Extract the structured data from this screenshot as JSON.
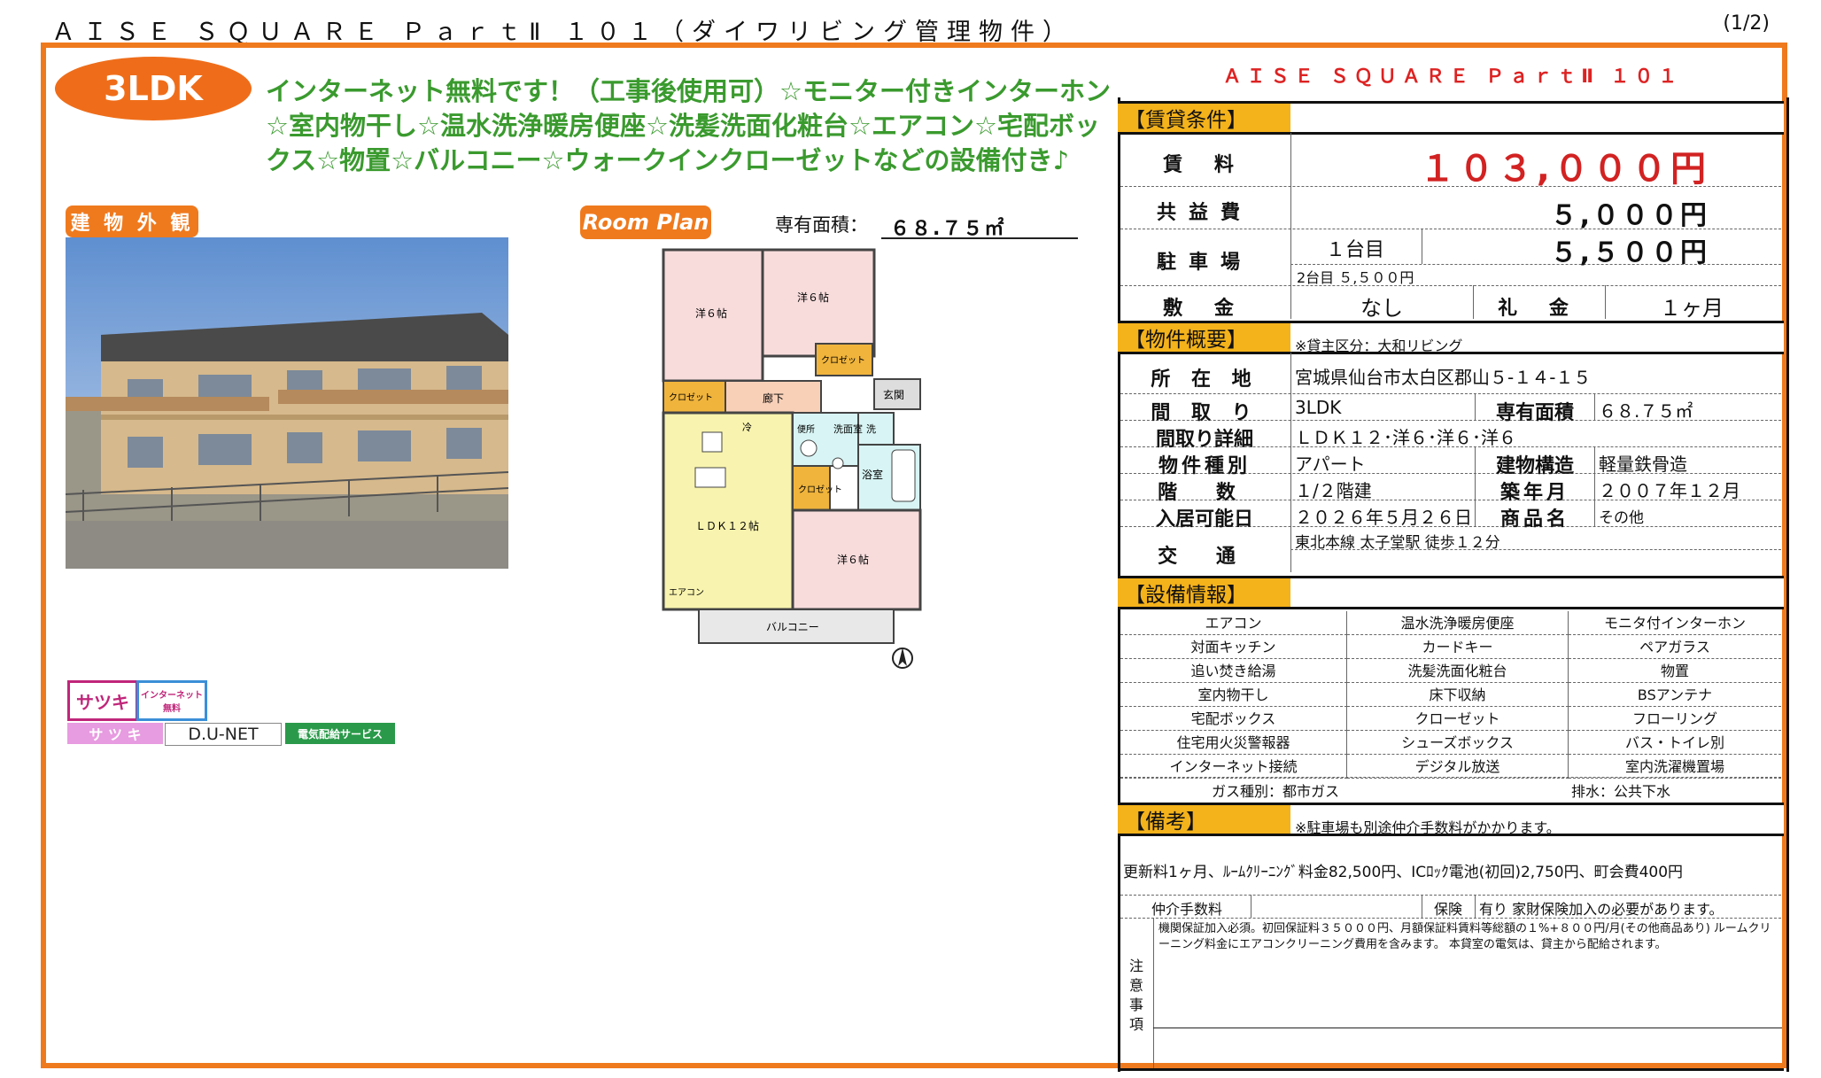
{
  "header": {
    "title": "ＡＩＳＥ ＳＱＵＡＲＥ ＰａｒｔⅡ １０１（ダイワリビング管理物件）",
    "page": "(1/2)"
  },
  "layout_badge": "3LDK",
  "pr_text": "インターネット無料です！（工事後使用可）☆モニター付きインターホン☆室内物干し☆温水洗浄暖房便座☆洗髪洗面化粧台☆エアコン☆宅配ボックス☆物置☆バルコニー☆ウォークインクローゼットなどの設備付き♪",
  "exterior_label": "建 物 外 観",
  "room_plan_label": "Room Plan",
  "area_label": "専有面積：",
  "area_value": "６８.７５㎡",
  "floor_plan": {
    "rooms": [
      "洋６帖",
      "洋６帖",
      "洋６帖",
      "ＬＤＫ１２帖"
    ],
    "closets": [
      "クロゼット",
      "クロゼット",
      "クロゼット"
    ],
    "hall": "廊下",
    "entrance": "玄関",
    "washroom": "洗面室",
    "bath": "浴室",
    "toilet": "便所",
    "fridge": "冷",
    "washer": "洗",
    "aircon": "エアコン",
    "balcony": "バルコニー"
  },
  "logos": {
    "satsuki": "サツキ",
    "internet_free": "インターネット 無料",
    "satsuki_kana": "サ ツ キ",
    "dunet": "D.U-NET",
    "power": "電気配給サービス"
  },
  "property_name": "ＡＩＳＥ ＳＱＵＡＲＥ ＰａｒｔⅡ １０１",
  "rent": {
    "section": "【賃貸条件】",
    "rent_label": "賃 料",
    "rent_value": "１０３,０００円",
    "common_label": "共益費",
    "common_value": "５,０００円",
    "parking_label": "駐車場",
    "parking_first": "１台目",
    "parking_first_value": "５,５００円",
    "parking_second": "2台目 ５,５００円",
    "deposit_label": "敷 金",
    "deposit_value": "なし",
    "key_money_label": "礼 金",
    "key_money_value": "１ヶ月"
  },
  "overview": {
    "section": "【物件概要】",
    "note": "※貸主区分：大和リビング",
    "address_label": "所 在 地",
    "address": "宮城県仙台市太白区郡山５-１４-１５",
    "layout_label": "間 取 り",
    "layout": "3LDK",
    "area_label": "専有面積",
    "area": "６８.７５㎡",
    "detail_label": "間取り詳細",
    "detail": "ＬＤＫ１２･洋６･洋６･洋６",
    "type_label": "物件種別",
    "type": "アパート",
    "structure_label": "建物構造",
    "structure": "軽量鉄骨造",
    "floors_label": "階 数",
    "floors": "１/２階建",
    "built_label": "築年月",
    "built": "２００７年１２月",
    "move_label": "入居可能日",
    "move": "２０２６年５月２６日",
    "product_label": "商品名",
    "product": "その他",
    "access_label": "交 通",
    "access": "東北本線 太子堂駅 徒歩１２分"
  },
  "equipment": {
    "section": "【設備情報】",
    "rows": [
      [
        "エアコン",
        "温水洗浄暖房便座",
        "モニタ付インターホン"
      ],
      [
        "対面キッチン",
        "カードキー",
        "ペアガラス"
      ],
      [
        "追い焚き給湯",
        "洗髪洗面化粧台",
        "物置"
      ],
      [
        "室内物干し",
        "床下収納",
        "BSアンテナ"
      ],
      [
        "宅配ボックス",
        "クローゼット",
        "フローリング"
      ],
      [
        "住宅用火災警報器",
        "シューズボックス",
        "バス・トイレ別"
      ],
      [
        "インターネット接続",
        "デジタル放送",
        "室内洗濯機置場"
      ]
    ],
    "gas": "ガス種別：都市ガス",
    "drain": "排水：公共下水"
  },
  "remarks": {
    "section": "【備考】",
    "note": "※駐車場も別途仲介手数料がかかります。",
    "renewal": "更新料1ヶ月、ﾙｰﾑｸﾘｰﾆﾝｸﾞ料金82,500円、ICﾛｯｸ電池(初回)2,750円、町会費400円",
    "fee_label": "仲介手数料",
    "fee_value": "",
    "insurance_label": "保険",
    "insurance_value": "有り 家財保険加入の必要があります。",
    "caution_label": "注意事項",
    "caution_text": "機関保証加入必須。初回保証料３５０００円、月額保証料賃料等総額の１%+８００円/月(その他商品あり) ルームクリーニング料金にエアコンクリーニング費用を含みます。 本貸室の電気は、貸主から配給されます。"
  },
  "colors": {
    "frame": "#ef7a1e",
    "accent_green": "#3a9a2e",
    "rent_red": "#d22222",
    "section_yellow": "#f4b21b"
  }
}
